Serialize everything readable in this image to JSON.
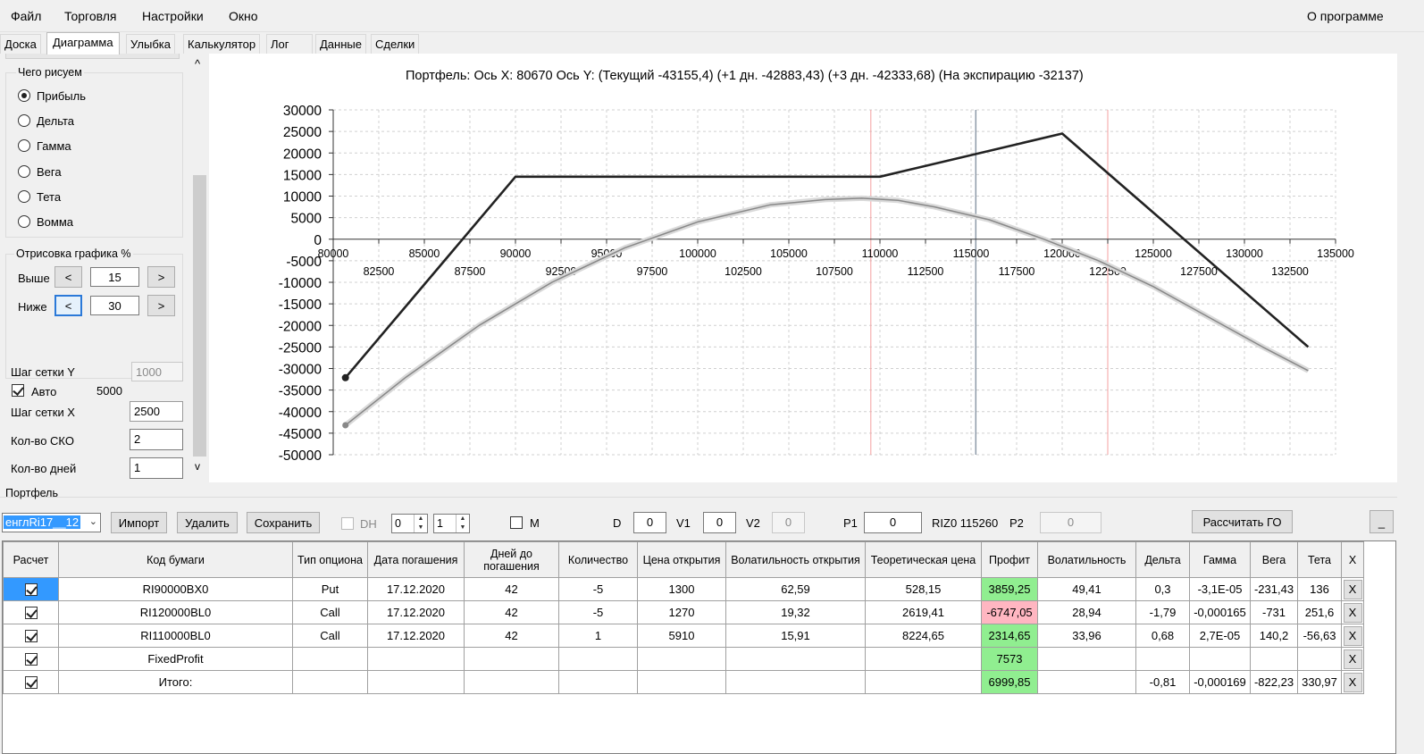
{
  "menu": {
    "file": "Файл",
    "trade": "Торговля",
    "settings": "Настройки",
    "window": "Окно",
    "about": "О программе"
  },
  "tabs": [
    "Доска",
    "Диаграмма",
    "Улыбка",
    "Калькулятор",
    "Лог",
    "Данные",
    "Сделки"
  ],
  "left": {
    "draw_group": "Чего рисуем",
    "options": [
      "Прибыль",
      "Дельта",
      "Гамма",
      "Вега",
      "Тета",
      "Вомма"
    ],
    "selected": "Прибыль",
    "render_group": "Отрисовка графика %",
    "above_label": "Выше",
    "above_value": "15",
    "below_label": "Ниже",
    "below_value": "30",
    "prev_glyph": "<",
    "next_glyph": ">",
    "grid_y_label": "Шаг сетки Y",
    "grid_y_value": "1000",
    "auto_label": "Авто",
    "auto_value": "5000",
    "grid_x_label": "Шаг сетки X",
    "grid_x_value": "2500",
    "sko_label": "Кол-во СКО",
    "sko_value": "2",
    "days_label": "Кол-во дней",
    "days_value": "1",
    "scroll_up": "^",
    "scroll_down": "v"
  },
  "chart": {
    "title": "Портфель: Ось X: 80670 Ось Y:  (Текущий -43155,4)  (+1 дн. -42883,43)  (+3 дн. -42333,68)  (На экспирацию -32137)"
  },
  "chart_data": {
    "type": "line",
    "title": "Портфель: Ось X: 80670 Ось Y:  (Текущий -43155,4)  (+1 дн. -42883,43)  (+3 дн. -42333,68)  (На экспирацию -32137)",
    "xlim": [
      80000,
      135000
    ],
    "ylim": [
      -50000,
      30000
    ],
    "x_ticks_top": [
      "80000",
      "85000",
      "90000",
      "95000",
      "100000",
      "105000",
      "110000",
      "115000",
      "120000",
      "125000",
      "130000",
      "135000"
    ],
    "x_ticks_bottom": [
      "82500",
      "87500",
      "92500",
      "97500",
      "102500",
      "107500",
      "112500",
      "117500",
      "122500",
      "127500",
      "132500"
    ],
    "y_ticks": [
      "30000",
      "25000",
      "20000",
      "15000",
      "10000",
      "5000",
      "0",
      "-5000",
      "-10000",
      "-15000",
      "-20000",
      "-25000",
      "-30000",
      "-35000",
      "-40000",
      "-45000",
      "-50000"
    ],
    "vlines": {
      "pink": [
        109500,
        122500
      ],
      "current": 115260
    },
    "grid": true,
    "series": [
      {
        "color": "#222222",
        "x": [
          80670,
          90000,
          110000,
          120000,
          133500
        ],
        "y": [
          -32137,
          14500,
          14500,
          24500,
          -25000
        ]
      },
      {
        "color": "#a8a8a8",
        "x": [
          80670,
          84000,
          88000,
          92000,
          96000,
          100000,
          104000,
          107000,
          109000,
          111000,
          113000,
          116000,
          119000,
          122000,
          125000,
          128000,
          131000,
          133500
        ],
        "y": [
          -43155,
          -32000,
          -20000,
          -10000,
          -2000,
          4000,
          8000,
          9200,
          9500,
          9000,
          7500,
          4500,
          0,
          -5000,
          -11000,
          -18000,
          -25000,
          -30500
        ]
      }
    ]
  },
  "portfolio": {
    "label": "Портфель",
    "combo_value": "енглRi17__12",
    "import": "Импорт",
    "delete": "Удалить",
    "save": "Сохранить",
    "dh": "DH",
    "spin1": "0",
    "spin2": "1",
    "m": "M",
    "d_label": "D",
    "d_value": "0",
    "v1_label": "V1",
    "v1_value": "0",
    "v2_label": "V2",
    "v2_value": "0",
    "p1_label": "P1",
    "p1_value": "0",
    "riz": "RIZ0 115260",
    "p2_label": "P2",
    "p2_value": "0",
    "calc_go": "Рассчитать ГО",
    "minimize": "_"
  },
  "table": {
    "headers": [
      "Расчет",
      "Код бумаги",
      "Тип опциона",
      "Дата погашения",
      "Дней до погашения",
      "Количество",
      "Цена открытия",
      "Волатильность открытия",
      "Теоретическая цена",
      "Профит",
      "Волатильность",
      "Дельта",
      "Гамма",
      "Вега",
      "Тета",
      "X"
    ],
    "rows": [
      [
        "",
        "RI90000BX0",
        "Put",
        "17.12.2020",
        "42",
        "-5",
        "1300",
        "62,59",
        "528,15",
        "3859,25",
        "49,41",
        "0,3",
        "-3,1E-05",
        "-231,43",
        "136",
        "X"
      ],
      [
        "",
        "RI120000BL0",
        "Call",
        "17.12.2020",
        "42",
        "-5",
        "1270",
        "19,32",
        "2619,41",
        "-6747,05",
        "28,94",
        "-1,79",
        "-0,000165",
        "-731",
        "251,6",
        "X"
      ],
      [
        "",
        "RI110000BL0",
        "Call",
        "17.12.2020",
        "42",
        "1",
        "5910",
        "15,91",
        "8224,65",
        "2314,65",
        "33,96",
        "0,68",
        "2,7E-05",
        "140,2",
        "-56,63",
        "X"
      ],
      [
        "",
        "FixedProfit",
        "",
        "",
        "",
        "",
        "",
        "",
        "",
        "7573",
        "",
        "",
        "",
        "",
        "",
        "X"
      ],
      [
        "",
        "Итого:",
        "",
        "",
        "",
        "",
        "",
        "",
        "",
        "6999,85",
        "",
        "-0,81",
        "-0,000169",
        "-822,23",
        "330,97",
        "X"
      ]
    ]
  }
}
